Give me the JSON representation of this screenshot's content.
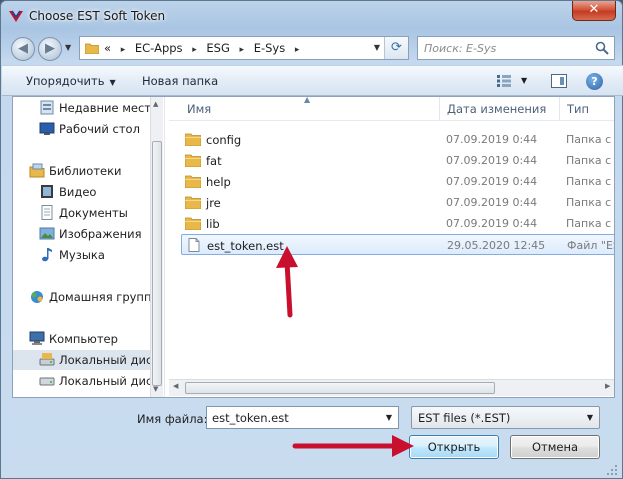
{
  "window": {
    "title": "Choose EST Soft Token",
    "close_glyph": "✕"
  },
  "address": {
    "prefix": "«",
    "crumbs": [
      "EC-Apps",
      "ESG",
      "E-Sys"
    ],
    "separator": "▸"
  },
  "search": {
    "placeholder": "Поиск: E-Sys"
  },
  "toolbar": {
    "organize": "Упорядочить",
    "new_folder": "Новая папка",
    "help": "?"
  },
  "nav": {
    "items": [
      {
        "label": "Недавние места",
        "icon": "recent-places-icon"
      },
      {
        "label": "Рабочий стол",
        "icon": "desktop-icon"
      },
      {
        "label": "Библиотеки",
        "icon": "libraries-icon"
      },
      {
        "label": "Видео",
        "icon": "video-icon"
      },
      {
        "label": "Документы",
        "icon": "documents-icon"
      },
      {
        "label": "Изображения",
        "icon": "images-icon"
      },
      {
        "label": "Музыка",
        "icon": "music-icon"
      },
      {
        "label": "Домашняя группа",
        "icon": "homegroup-icon"
      },
      {
        "label": "Компьютер",
        "icon": "computer-icon"
      },
      {
        "label": "Локальный диск",
        "icon": "local-disk-icon"
      },
      {
        "label": "Локальный диск",
        "icon": "local-disk-icon"
      }
    ]
  },
  "columns": {
    "name": "Имя",
    "date": "Дата изменения",
    "type": "Тип"
  },
  "files": [
    {
      "name": "config",
      "date": "07.09.2019 0:44",
      "type": "Папка с ф",
      "kind": "folder"
    },
    {
      "name": "fat",
      "date": "07.09.2019 0:44",
      "type": "Папка с ф",
      "kind": "folder"
    },
    {
      "name": "help",
      "date": "07.09.2019 0:44",
      "type": "Папка с ф",
      "kind": "folder"
    },
    {
      "name": "jre",
      "date": "07.09.2019 0:44",
      "type": "Папка с ф",
      "kind": "folder"
    },
    {
      "name": "lib",
      "date": "07.09.2019 0:44",
      "type": "Папка с ф",
      "kind": "folder"
    },
    {
      "name": "est_token.est",
      "date": "29.05.2020 12:45",
      "type": "Файл \"ES",
      "kind": "file",
      "selected": true
    }
  ],
  "footer": {
    "filename_label": "Имя файла:",
    "filename_value": "est_token.est",
    "filter_value": "EST files (*.EST)",
    "open_button": "Открыть",
    "cancel_button": "Отмена"
  },
  "colors": {
    "annotation_arrow": "#c8102e",
    "selection_border": "#84acdd",
    "folder": "#e8b84a"
  }
}
